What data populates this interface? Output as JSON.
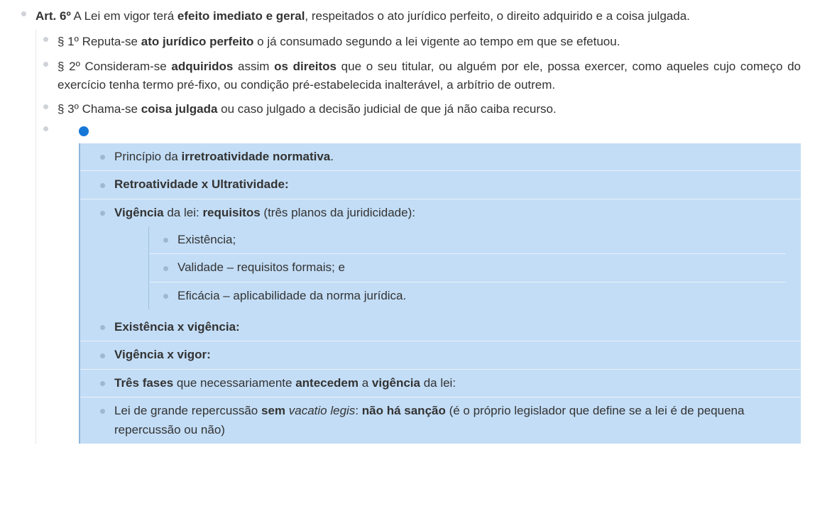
{
  "art6": {
    "prefix": "Art. 6º",
    "mid": " A Lei em vigor terá ",
    "bold1": "efeito imediato e geral",
    "tail": ", respeitados o ato jurídico perfeito, o direito adquirido e a coisa julgada."
  },
  "p1": {
    "lead": "§ 1º Reputa-se ",
    "bold": "ato jurídico perfeito",
    "tail": " o já consumado segundo a lei vigente ao tempo em que se efetuou."
  },
  "p2": {
    "lead": "§ 2º Consideram-se ",
    "bold1": "adquiridos",
    "mid": " assim ",
    "bold2": "os direitos",
    "tail": " que o seu titular, ou alguém por ele, possa exercer, como aqueles cujo começo do exercício tenha termo pré-fixo, ou condição pré-estabelecida inalterável, a arbítrio de outrem."
  },
  "p3": {
    "lead": "§ 3º Chama-se ",
    "bold": "coisa julgada",
    "tail": " ou caso julgado a decisão judicial de que já não caiba recurso."
  },
  "hl": {
    "row1_a": "Princípio da ",
    "row1_b": "irretroatividade normativa",
    "row1_c": ".",
    "row2": "Retroatividade x Ultratividade:",
    "row3_a": "Vigência",
    "row3_b": " da lei: ",
    "row3_c": "requisitos",
    "row3_d": " (três planos da juridicidade):",
    "sub1": "Existência;",
    "sub2": "Validade – requisitos formais; e",
    "sub3": "Eficácia – aplicabilidade da norma jurídica.",
    "row4": "Existência x vigência:",
    "row5": "Vigência x vigor:",
    "row6_a": "Três fases",
    "row6_b": " que necessariamente ",
    "row6_c": "antecedem",
    "row6_d": " a ",
    "row6_e": "vigência",
    "row6_f": " da lei:",
    "row7_a": "Lei de grande repercussão ",
    "row7_b": "sem",
    "row7_c": " ",
    "row7_d": "vacatio legis",
    "row7_e": ": ",
    "row7_f": "não há sanção",
    "row7_g": " (é o próprio legislador que define se a lei é de pequena repercussão ou não)"
  }
}
